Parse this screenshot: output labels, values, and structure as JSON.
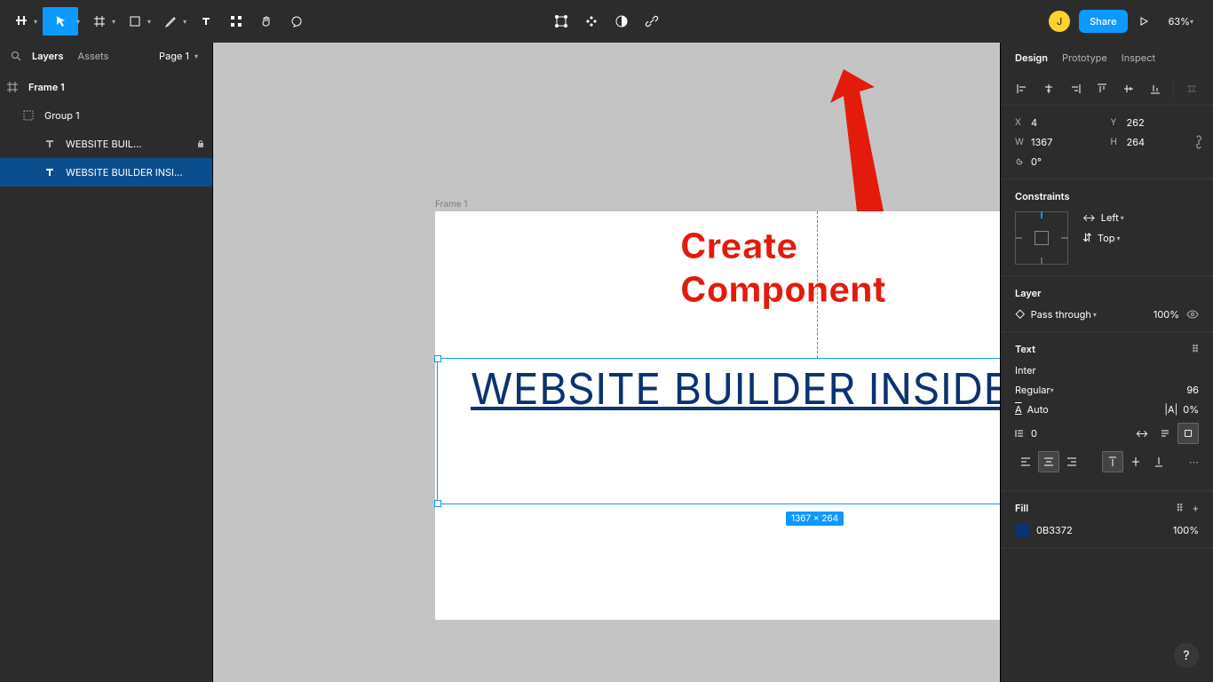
{
  "toolbar": {
    "zoom": "63%",
    "avatar_initial": "J",
    "share_label": "Share"
  },
  "left_panel": {
    "tabs": {
      "layers": "Layers",
      "assets": "Assets"
    },
    "page": "Page 1",
    "layers": [
      {
        "name": "Frame 1",
        "type": "frame"
      },
      {
        "name": "Group 1",
        "type": "group"
      },
      {
        "name": "WEBSITE BUIL...",
        "type": "text",
        "locked": true
      },
      {
        "name": "WEBSITE BUILDER INSI...",
        "type": "text",
        "selected": true
      }
    ]
  },
  "canvas": {
    "frame_label": "Frame 1",
    "text_content": "WEBSITE BUILDER INSIDER",
    "annotation": "Create Component",
    "selection_dim": "1367 × 264"
  },
  "design": {
    "tabs": {
      "design": "Design",
      "prototype": "Prototype",
      "inspect": "Inspect"
    },
    "X": "4",
    "Y": "262",
    "W": "1367",
    "H": "264",
    "rotation": "0°",
    "constraints": {
      "title": "Constraints",
      "h": "Left",
      "v": "Top"
    },
    "layer": {
      "title": "Layer",
      "blend": "Pass through",
      "opacity": "100%"
    },
    "text": {
      "title": "Text",
      "font": "Inter",
      "weight": "Regular",
      "size": "96",
      "line_height": "Auto",
      "letter_spacing": "0%",
      "paragraph": "0"
    },
    "fill": {
      "title": "Fill",
      "hex": "0B3372",
      "opacity": "100%"
    }
  }
}
